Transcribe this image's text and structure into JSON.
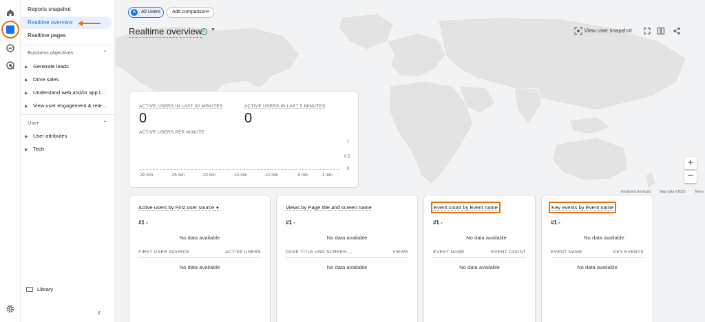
{
  "nav": {
    "links": [
      "Reports snapshot",
      "Realtime overview",
      "Realtime pages"
    ],
    "active_link_index": 1,
    "sections": [
      {
        "title": "Business objectives",
        "items": [
          "Generate leads",
          "Drive sales",
          "Understand web and/or app t...",
          "View user engagement & rete..."
        ]
      },
      {
        "title": "User",
        "items": [
          "User attributes",
          "Tech"
        ]
      }
    ],
    "library": "Library",
    "collapse_icon": "chevron-left-icon"
  },
  "rail": {
    "icons": [
      "home-icon",
      "reports-icon",
      "explore-icon",
      "advertising-icon",
      "settings-icon"
    ],
    "active_icon": "reports-icon"
  },
  "header": {
    "chips": {
      "all_users_badge": "A",
      "all_users": "All Users",
      "add_comparison": "Add comparison"
    },
    "title": "Realtime overview",
    "actions": {
      "view_snapshot": "View user snapshot"
    }
  },
  "map": {
    "keyboard_shortcuts": "Keyboard shortcuts",
    "map_data": "Map data ©2025",
    "terms": "Terms",
    "zoom_in": "+",
    "zoom_out": "−"
  },
  "realtime_card": {
    "label_30": "ACTIVE USERS IN LAST 30 MINUTES",
    "value_30": "0",
    "label_5": "ACTIVE USERS IN LAST 5 MINUTES",
    "value_5": "0",
    "per_minute_label": "ACTIVE USERS PER MINUTE",
    "y_ticks": [
      "1",
      "0.5",
      "0"
    ],
    "x_ticks": [
      "-30 min",
      "-25 min",
      "-20 min",
      "-15 min",
      "-10 min",
      "-5 min",
      "-1 min"
    ]
  },
  "cards": [
    {
      "title_prefix": "Active users",
      "title_suffix": " by First user source",
      "rank": "#1  -",
      "nodata_top": "No data available",
      "col_left": "FIRST USER SOURCE",
      "col_right": "ACTIVE USERS",
      "nodata_bottom": "No data available",
      "highlighted": false
    },
    {
      "title": "Views by Page title and screen name",
      "rank": "#1  -",
      "nodata_top": "No data available",
      "col_left": "PAGE TITLE AND SCREEN ...",
      "col_right": "VIEWS",
      "nodata_bottom": "No data available",
      "highlighted": false
    },
    {
      "title": "Event count by Event name",
      "rank": "#1  -",
      "nodata_top": "No data available",
      "col_left": "EVENT NAME",
      "col_right": "EVENT COUNT",
      "nodata_bottom": "No data available",
      "highlighted": true
    },
    {
      "title": "Key events by Event name",
      "rank": "#1  -",
      "nodata_top": "No data available",
      "col_left": "EVENT NAME",
      "col_right": "KEY EVENTS",
      "nodata_bottom": "No data available",
      "highlighted": true
    }
  ],
  "annotation_color": "#e8710a",
  "accent_color": "#1a73e8"
}
